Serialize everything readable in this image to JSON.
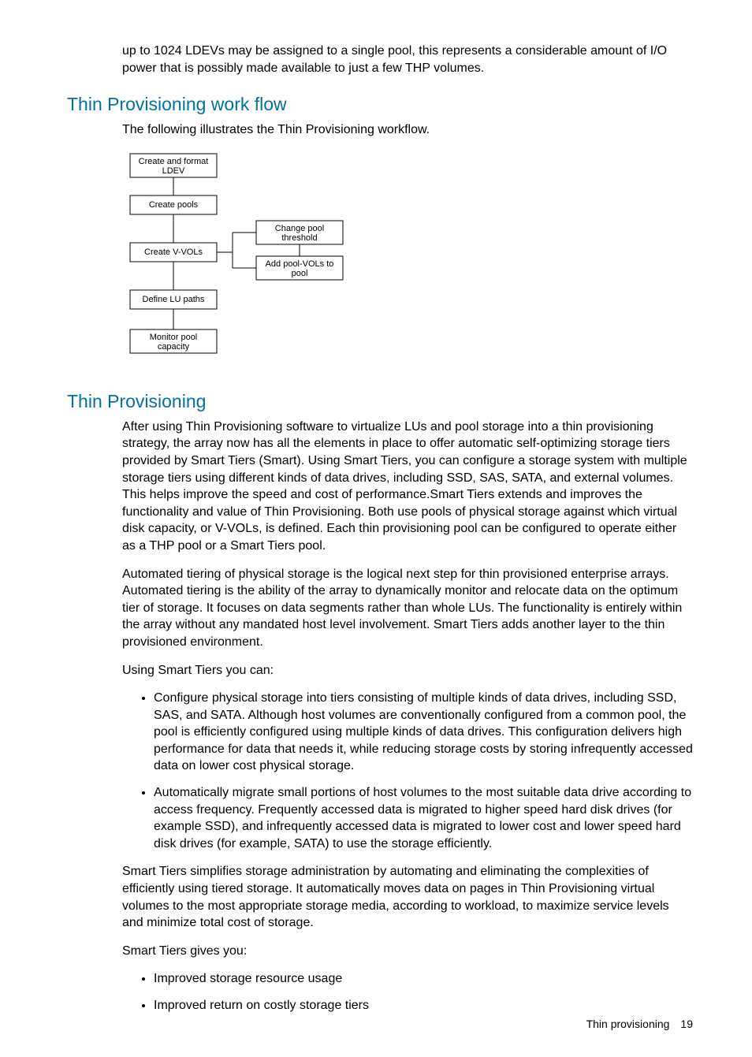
{
  "intro": "up to 1024 LDEVs may be assigned to a single pool, this represents a considerable amount of I/O power that is possibly made available to just a few THP volumes.",
  "section1": {
    "heading": "Thin Provisioning work flow",
    "lead": "The following illustrates the Thin Provisioning workflow."
  },
  "flowchart": {
    "b1a": "Create and format",
    "b1b": "LDEV",
    "b2": "Create pools",
    "b3": "Create V-VOLs",
    "b4": "Define LU paths",
    "b5a": "Monitor pool",
    "b5b": "capacity",
    "s1a": "Change pool",
    "s1b": "threshold",
    "s2a": "Add pool-VOLs to",
    "s2b": "pool"
  },
  "section2": {
    "heading": "Thin Provisioning",
    "p1": "After using Thin Provisioning software to virtualize LUs and pool storage into a thin provisioning strategy, the array now has all the elements in place to offer automatic self-optimizing storage tiers provided by Smart Tiers (Smart). Using Smart Tiers, you can configure a storage system with multiple storage tiers using different kinds of data drives, including SSD, SAS, SATA, and external volumes. This helps improve the speed and cost of performance.Smart Tiers extends and improves the functionality and value of Thin Provisioning. Both use pools of physical storage against which virtual disk capacity, or V-VOLs, is defined. Each thin provisioning pool can be configured to operate either as a THP pool or a Smart Tiers pool.",
    "p2": "Automated tiering of physical storage is the logical next step for thin provisioned enterprise arrays. Automated tiering is the ability of the array to dynamically monitor and relocate data on the optimum tier of storage. It focuses on data segments rather than whole LUs. The functionality is entirely within the array without any mandated host level involvement. Smart Tiers adds another layer to the thin provisioned environment.",
    "p3": "Using Smart Tiers you can:",
    "bullets1": [
      "Configure physical storage into tiers consisting of multiple kinds of data drives, including SSD, SAS, and SATA. Although host volumes are conventionally configured from a common pool, the pool is efficiently configured using multiple kinds of data drives. This configuration delivers high performance for data that needs it, while reducing storage costs by storing infrequently accessed data on lower cost physical storage.",
      "Automatically migrate small portions of host volumes to the most suitable data drive according to access frequency. Frequently accessed data is migrated to higher speed hard disk drives (for example SSD), and infrequently accessed data is migrated to lower cost and lower speed hard disk drives (for example, SATA) to use the storage efficiently."
    ],
    "p4": "Smart Tiers simplifies storage administration by automating and eliminating the complexities of efficiently using tiered storage. It automatically moves data on pages in Thin Provisioning virtual volumes to the most appropriate storage media, according to workload, to maximize service levels and minimize total cost of storage.",
    "p5": "Smart Tiers gives you:",
    "bullets2": [
      "Improved storage resource usage",
      "Improved return on costly storage tiers"
    ]
  },
  "footer": {
    "label": "Thin provisioning",
    "page": "19"
  }
}
